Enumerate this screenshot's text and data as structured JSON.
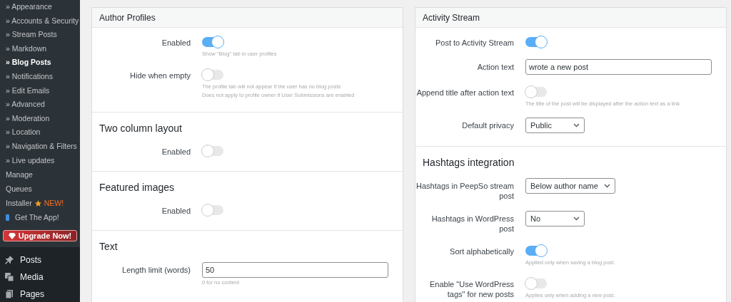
{
  "sidebar": {
    "submenu": [
      {
        "label": "» Appearance",
        "selected": false
      },
      {
        "label": "» Accounts & Security",
        "selected": false
      },
      {
        "label": "» Stream Posts",
        "selected": false
      },
      {
        "label": "» Markdown",
        "selected": false
      },
      {
        "label": "» Blog Posts",
        "selected": true
      },
      {
        "label": "» Notifications",
        "selected": false
      },
      {
        "label": "» Edit Emails",
        "selected": false
      },
      {
        "label": "» Advanced",
        "selected": false
      },
      {
        "label": "» Moderation",
        "selected": false
      },
      {
        "label": "» Location",
        "selected": false
      },
      {
        "label": "» Navigation & Filters",
        "selected": false
      },
      {
        "label": "» Live updates",
        "selected": false
      }
    ],
    "links": [
      {
        "kind": "plain",
        "label": "Manage"
      },
      {
        "kind": "plain",
        "label": "Queues"
      },
      {
        "kind": "badge",
        "label": "Installer",
        "badge": "NEW!"
      },
      {
        "kind": "app",
        "label": "Get The App!"
      }
    ],
    "upgrade": "Upgrade Now!",
    "menu": [
      {
        "kind": "pin",
        "label": "Posts"
      },
      {
        "kind": "media",
        "label": "Media"
      },
      {
        "kind": "pages",
        "label": "Pages"
      }
    ]
  },
  "panels": [
    {
      "title": "Author Profiles",
      "groups": [
        {
          "rows": [
            {
              "kind": "toggle",
              "label": "Enabled",
              "on": true,
              "help": [
                "Show \"Blog\" tab in user profiles"
              ]
            },
            {
              "kind": "toggle",
              "label": "Hide when empty",
              "on": false,
              "help": [
                "The profile tab will not appear if the user has no blog posts",
                "Does not apply to profile owner if User Submissions are enabled"
              ]
            }
          ]
        },
        {
          "heading": "Two column layout",
          "rows": [
            {
              "kind": "toggle",
              "label": "Enabled",
              "on": false
            }
          ]
        },
        {
          "heading": "Featured images",
          "rows": [
            {
              "kind": "toggle",
              "label": "Enabled",
              "on": false
            }
          ]
        },
        {
          "heading": "Text",
          "rows": [
            {
              "kind": "text",
              "label": "Length limit (words)",
              "value": "50",
              "help": [
                "0 for no content"
              ]
            }
          ]
        }
      ]
    },
    {
      "title": "Activity Stream",
      "groups": [
        {
          "rows": [
            {
              "kind": "toggle",
              "label": "Post to Activity Stream",
              "on": true
            },
            {
              "kind": "text",
              "label": "Action text",
              "value": "wrote a new post"
            },
            {
              "kind": "toggle",
              "label": "Append title after action text",
              "on": false,
              "help": [
                "The title of the post will be displayed after the action text as a link"
              ]
            },
            {
              "kind": "select",
              "label": "Default privacy",
              "value": "Public"
            }
          ]
        },
        {
          "heading": "Hashtags integration",
          "rows": [
            {
              "kind": "select",
              "label": "Hashtags in PeepSo stream post",
              "value": "Below author name"
            },
            {
              "kind": "select",
              "label": "Hashtags in WordPress post",
              "value": "No"
            },
            {
              "kind": "toggle",
              "label": "Sort alphabetically",
              "on": true,
              "help": [
                "Applied only when saving a blog post."
              ]
            },
            {
              "kind": "toggle",
              "label": "Enable \"Use WordPress tags\" for new posts",
              "on": false,
              "help": [
                "Applies only when adding a new post."
              ]
            }
          ]
        }
      ]
    }
  ]
}
